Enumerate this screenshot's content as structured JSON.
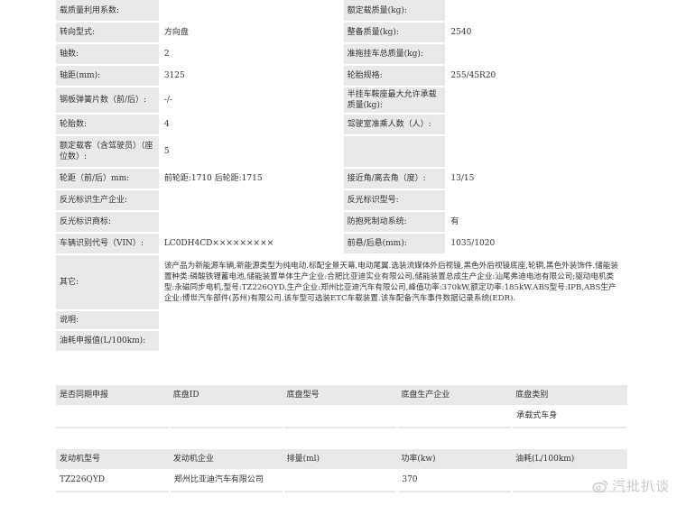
{
  "spec_rows": [
    {
      "l1": "载质量利用系数:",
      "v1": "",
      "l2": "额定载质量(kg):",
      "v2": ""
    },
    {
      "l1": "转向型式:",
      "v1": "方向盘",
      "l2": "整备质量(kg):",
      "v2": "2540"
    },
    {
      "l1": "轴数:",
      "v1": "2",
      "l2": "准拖挂车总质量(kg):",
      "v2": ""
    },
    {
      "l1": "轴距(mm):",
      "v1": "3125",
      "l2": "轮胎规格:",
      "v2": "255/45R20"
    },
    {
      "l1": "钢板弹簧片数（前/后）:",
      "v1": "-/-",
      "l2": "半挂车鞍座最大允许承载质量(kg):",
      "v2": ""
    },
    {
      "l1": "轮胎数:",
      "v1": "4",
      "l2": "驾驶室准乘人数（人）:",
      "v2": ""
    },
    {
      "l1": "额定载客（含驾驶员）（座位数）:",
      "v1": "5",
      "l2": "",
      "v2": ""
    },
    {
      "l1": "轮距（前/后）mm:",
      "v1": "前轮距:1710 后轮距:1715",
      "l2": "接近角/离去角（度）:",
      "v2": "13/15"
    },
    {
      "l1": "反光标识生产企业:",
      "v1": "",
      "l2": "反光标识型号:",
      "v2": ""
    },
    {
      "l1": "反光标识商标:",
      "v1": "",
      "l2": "防抱死制动系统:",
      "v2": "有"
    },
    {
      "l1": "车辆识别代号（VIN）:",
      "v1": "LC0DH4CD×××××××××",
      "l2": "前悬/后悬(mm):",
      "v2": "1035/1020"
    }
  ],
  "other_label": "其它:",
  "other_text": "该产品为新能源车辆,新能源类型为纯电动.标配全景天幕,电动尾翼.选装流媒体外后视镜,黑色外后视镜底座,轮辋,黑色外装饰件.储能装置种类:磷酸铁锂蓄电池,储能装置单体生产企业:合肥比亚迪实业有限公司,储能装置总成生产企业:汕尾弗迪电池有限公司;驱动电机类型:永磁同步电机,型号:TZ226QYD,生产企业:郑州比亚迪汽车有限公司,峰值功率:370kW,额定功率:185kW.ABS型号:IPB,ABS生产企业:博世汽车部件(苏州)有限公司.该车型可选装ETC车载装置.该车配备汽车事件数据记录系统(EDR).",
  "note_label": "说明:",
  "note_text": "",
  "fuel_label": "油耗申报值(L/100km):",
  "fuel_text": "",
  "chassis_headers": [
    "是否同期申报",
    "底盘ID",
    "底盘型号",
    "底盘生产企业",
    "底盘类别"
  ],
  "chassis_row": [
    "",
    "",
    "",
    "",
    "承载式车身"
  ],
  "engine_headers": [
    "发动机型号",
    "发动机企业",
    "排量(ml)",
    "功率(kw)",
    "油耗(L/100km)"
  ],
  "engine_row": [
    "TZ226QYD",
    "郑州比亚迪汽车有限公司",
    "",
    "370",
    ""
  ],
  "watermark": "汽批扒谈"
}
